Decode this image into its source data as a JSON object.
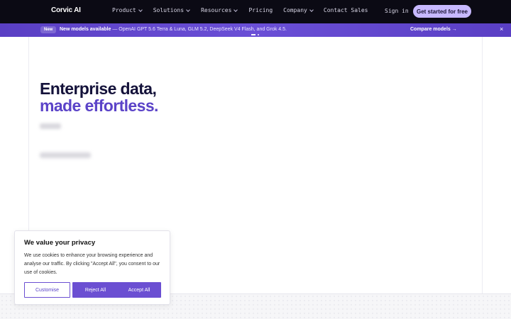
{
  "nav": {
    "logo": "Corvic AI",
    "menu": [
      {
        "label": "Product",
        "has_dropdown": true
      },
      {
        "label": "Solutions",
        "has_dropdown": true
      },
      {
        "label": "Resources",
        "has_dropdown": true
      },
      {
        "label": "Pricing",
        "has_dropdown": false
      },
      {
        "label": "Company",
        "has_dropdown": true
      },
      {
        "label": "Contact Sales",
        "has_dropdown": false
      }
    ],
    "signin": "Sign in",
    "cta": "Get started for free"
  },
  "banner": {
    "badge": "New",
    "headline": "New models available",
    "details": " — OpenAI GPT 5.6 Terra & Luna, GLM 5.2, DeepSeek V4 Flash, and Grok 4.5.",
    "link": "Compare models →",
    "close": "×"
  },
  "hero": {
    "title_line1": "Enterprise data,",
    "title_line2": "made effortless."
  },
  "cookie": {
    "title": "We value your privacy",
    "body": "We use cookies to enhance your browsing experience and analyse our traffic. By clicking \"Accept All\", you consent to our use of cookies.",
    "customise": "Customise",
    "reject": "Reject All",
    "accept": "Accept All"
  },
  "colors": {
    "nav_bg": "#0b0a14",
    "cta_bg": "#c7b8ff",
    "banner_bg": "#5a3fc4",
    "accent": "#6b4fd2",
    "hero_dark": "#14123a",
    "hero_accent": "#5b43c8"
  }
}
